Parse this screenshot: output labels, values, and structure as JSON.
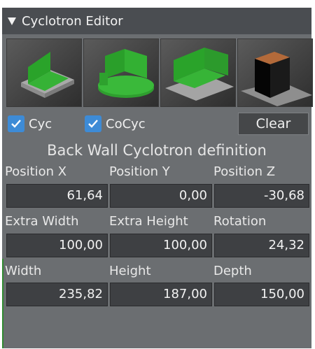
{
  "title": "Cyclotron Editor",
  "thumbnails": [
    {
      "name": "flat-floor-wall-preset",
      "icon": "cyc-flat-icon"
    },
    {
      "name": "curved-floor-preset",
      "icon": "cyc-curved-icon"
    },
    {
      "name": "corner-cyc-preset",
      "icon": "cyc-corner-icon"
    },
    {
      "name": "block-preset",
      "icon": "cyc-block-icon"
    }
  ],
  "checks": {
    "cyc": {
      "label": "Cyc",
      "checked": true
    },
    "cocyc": {
      "label": "CoCyc",
      "checked": true
    }
  },
  "clear_label": "Clear",
  "section_title": "Back Wall Cyclotron definition",
  "fields": {
    "position_x": {
      "label": "Position X",
      "value": "61,64"
    },
    "position_y": {
      "label": "Position Y",
      "value": "0,00"
    },
    "position_z": {
      "label": "Position Z",
      "value": "-30,68"
    },
    "extra_width": {
      "label": "Extra Width",
      "value": "100,00"
    },
    "extra_height": {
      "label": "Extra Height",
      "value": "100,00"
    },
    "rotation": {
      "label": "Rotation",
      "value": "24,32"
    },
    "width": {
      "label": "Width",
      "value": "235,82"
    },
    "height": {
      "label": "Height",
      "value": "187,00"
    },
    "depth": {
      "label": "Depth",
      "value": "150,00"
    }
  },
  "colors": {
    "panel": "#6b6e71",
    "titlebar": "#4a4d51",
    "field": "#3e4043",
    "check_accent": "#3d8bd6",
    "cyc_green": "#2ea12e"
  }
}
